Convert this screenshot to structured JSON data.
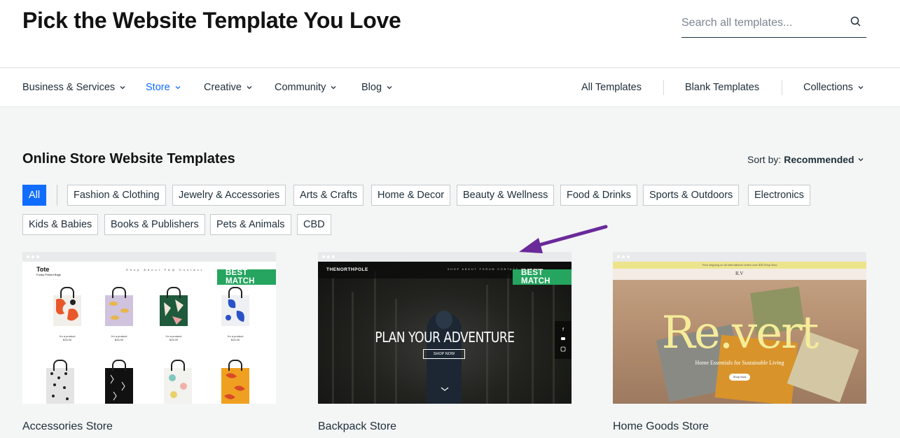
{
  "header": {
    "title": "Pick the Website Template You Love",
    "search_placeholder": "Search all templates..."
  },
  "nav": {
    "left": [
      {
        "label": "Business & Services",
        "active": false
      },
      {
        "label": "Store",
        "active": true
      },
      {
        "label": "Creative",
        "active": false
      },
      {
        "label": "Community",
        "active": false
      },
      {
        "label": "Blog",
        "active": false
      }
    ],
    "right": [
      {
        "label": "All Templates"
      },
      {
        "label": "Blank Templates"
      },
      {
        "label": "Collections",
        "dropdown": true
      }
    ]
  },
  "section": {
    "title": "Online Store Website Templates",
    "sort_prefix": "Sort by:",
    "sort_value": "Recommended"
  },
  "filters": [
    "All",
    "Fashion & Clothing",
    "Jewelry & Accessories",
    "Arts & Crafts",
    "Home & Decor",
    "Beauty & Wellness",
    "Food & Drinks",
    "Sports & Outdoors",
    "Electronics",
    "Kids & Babies",
    "Books & Publishers",
    "Pets & Animals",
    "CBD"
  ],
  "cards": [
    {
      "name": "Accessories Store",
      "badge": "BEST MATCH",
      "preview": {
        "logo": "Tote",
        "tagline": "Funky Printed Bags",
        "menu": "Shop About FAQ Contact",
        "product": "I'm a product",
        "price": "$15.00"
      }
    },
    {
      "name": "Backpack Store",
      "badge": "BEST MATCH",
      "preview": {
        "brand": "THENORTHPOLE",
        "menu": "SHOP ABOUT FORUM CONTACT SEARCH",
        "headline": "PLAN YOUR ADVENTURE",
        "cta": "SHOP NOW"
      }
    },
    {
      "name": "Home Goods Store",
      "badge": "",
      "preview": {
        "promo": "Free shipping on all international orders over $35 Shop Now",
        "logo": "R.V",
        "headline": "Re.vert",
        "tagline": "Home Essentials for Sustainable Living",
        "cta": "Shop Now"
      }
    }
  ],
  "colors": {
    "accent": "#116dff",
    "badge": "#25a55f",
    "annotation_arrow": "#6a2a9a"
  }
}
